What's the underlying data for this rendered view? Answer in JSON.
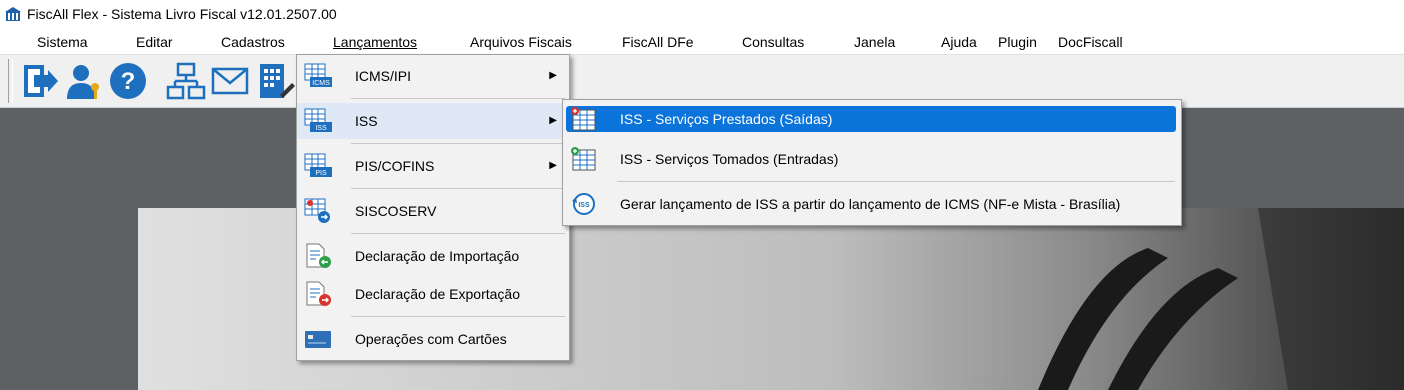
{
  "window": {
    "title": "FiscAll Flex - Sistema Livro Fiscal v12.01.2507.00"
  },
  "menubar": {
    "items": [
      {
        "label": "Sistema"
      },
      {
        "label": "Editar"
      },
      {
        "label": "Cadastros"
      },
      {
        "label": "Lançamentos"
      },
      {
        "label": "Arquivos Fiscais"
      },
      {
        "label": "FiscAll DFe"
      },
      {
        "label": "Consultas"
      },
      {
        "label": "Janela"
      },
      {
        "label": "Ajuda"
      },
      {
        "label": "Plugin"
      },
      {
        "label": "DocFiscall"
      }
    ]
  },
  "toolbar": {
    "buttons": [
      {
        "icon": "exit-icon"
      },
      {
        "icon": "user-key-icon"
      },
      {
        "icon": "help-icon"
      },
      {
        "icon": "org-chart-icon"
      },
      {
        "icon": "mail-icon"
      },
      {
        "icon": "calculator-edit-icon"
      }
    ]
  },
  "lancamentos_menu": {
    "items": [
      {
        "label": "ICMS/IPI",
        "badge": "ICMS",
        "has_submenu": true
      },
      {
        "label": "ISS",
        "badge": "ISS",
        "has_submenu": true
      },
      {
        "label": "PIS/COFINS",
        "badge": "PIS",
        "has_submenu": true
      },
      {
        "label": "SISCOSERV",
        "has_submenu": false
      },
      {
        "label": "Declaração de Importação",
        "has_submenu": false
      },
      {
        "label": "Declaração de Exportação",
        "has_submenu": false
      },
      {
        "label": "Operações com Cartões",
        "has_submenu": false
      }
    ],
    "arrow": "▶"
  },
  "iss_submenu": {
    "items": [
      {
        "label": "ISS - Serviços Prestados (Saídas)"
      },
      {
        "label": "ISS - Serviços Tomados (Entradas)"
      },
      {
        "label": "Gerar lançamento de ISS a partir do lançamento de ICMS (NF-e Mista - Brasília)",
        "badge": "ISS"
      }
    ]
  },
  "colors": {
    "highlight": "#0a74da",
    "workspace": "#5d6164",
    "accent_blue": "#1f6fbf"
  }
}
